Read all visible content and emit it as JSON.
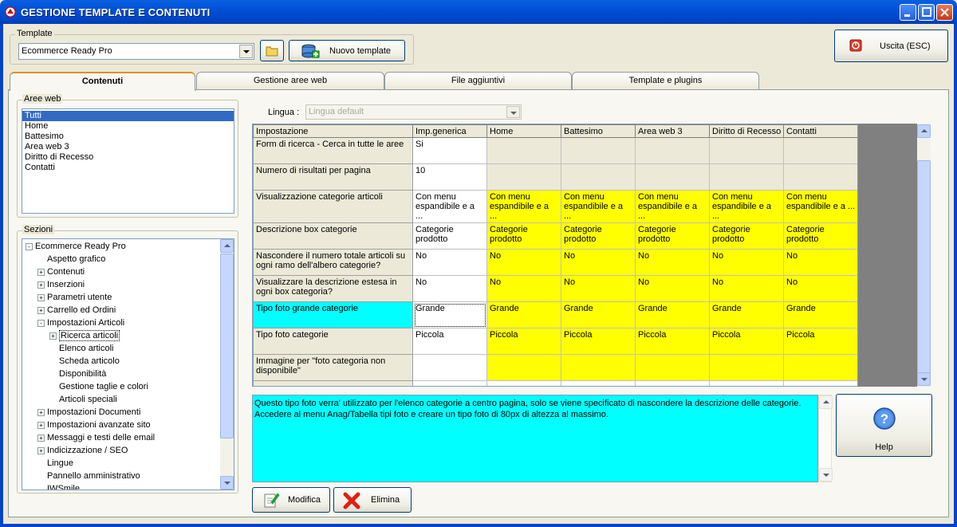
{
  "window": {
    "title": "GESTIONE TEMPLATE E CONTENUTI"
  },
  "template_group": {
    "legend": "Template",
    "selected": "Ecommerce Ready Pro",
    "new_template_label": "Nuovo template"
  },
  "exit_label": "Uscita (ESC)",
  "tabs": [
    "Contenuti",
    "Gestione aree web",
    "File aggiuntivi",
    "Template e plugins"
  ],
  "aree_web": {
    "legend": "Aree web",
    "items": [
      "Tutti",
      "Home",
      "Battesimo",
      "Area web 3",
      "Diritto di Recesso",
      "Contatti"
    ]
  },
  "sezioni": {
    "legend": "Sezioni",
    "nodes": [
      {
        "label": "Ecommerce Ready Pro",
        "level": 0,
        "pm": "-"
      },
      {
        "label": "Aspetto grafico",
        "level": 1,
        "pm": ""
      },
      {
        "label": "Contenuti",
        "level": 1,
        "pm": "+"
      },
      {
        "label": "Inserzioni",
        "level": 1,
        "pm": "+"
      },
      {
        "label": "Parametri utente",
        "level": 1,
        "pm": "+"
      },
      {
        "label": "Carrello ed Ordini",
        "level": 1,
        "pm": "+"
      },
      {
        "label": "Impostazioni Articoli",
        "level": 1,
        "pm": "-"
      },
      {
        "label": "Ricerca articoli",
        "level": 2,
        "pm": "+"
      },
      {
        "label": "Elenco articoli",
        "level": 2,
        "pm": ""
      },
      {
        "label": "Scheda articolo",
        "level": 2,
        "pm": ""
      },
      {
        "label": "Disponibilità",
        "level": 2,
        "pm": ""
      },
      {
        "label": "Gestione taglie e colori",
        "level": 2,
        "pm": ""
      },
      {
        "label": "Articoli speciali",
        "level": 2,
        "pm": ""
      },
      {
        "label": "Impostazioni Documenti",
        "level": 1,
        "pm": "+"
      },
      {
        "label": "Impostazioni avanzate sito",
        "level": 1,
        "pm": "+"
      },
      {
        "label": "Messaggi e testi delle email",
        "level": 1,
        "pm": "+"
      },
      {
        "label": "Indicizzazione / SEO",
        "level": 1,
        "pm": "+"
      },
      {
        "label": "Lingue",
        "level": 1,
        "pm": ""
      },
      {
        "label": "Pannello amministrativo",
        "level": 1,
        "pm": ""
      },
      {
        "label": "IWSmile",
        "level": 1,
        "pm": ""
      }
    ]
  },
  "lingua": {
    "label": "Lingua :",
    "value": "Lingua default"
  },
  "grid": {
    "columns": [
      "Impostazione",
      "Imp.generica",
      "Home",
      "Battesimo",
      "Area web 3",
      "Diritto di Recesso",
      "Contatti"
    ],
    "rows": [
      {
        "name": "Form di ricerca - Cerca in tutte le aree",
        "generic": "Si",
        "areas": [
          "",
          "",
          "",
          "",
          ""
        ],
        "style": "empty"
      },
      {
        "name": "Numero di risultati per pagina",
        "generic": "10",
        "areas": [
          "",
          "",
          "",
          "",
          ""
        ],
        "style": "empty"
      },
      {
        "name": "Visualizzazione categorie articoli",
        "generic": "Con menu espandibile e a ...",
        "areas": [
          "Con menu espandibile e a ...",
          "Con menu espandibile e a ...",
          "Con menu espandibile e a ...",
          "Con menu espandibile e a ...",
          "Con menu espandibile e a ..."
        ],
        "style": "yellow"
      },
      {
        "name": "Descrizione box categorie",
        "generic": "Categorie prodotto",
        "areas": [
          "Categorie prodotto",
          "Categorie prodotto",
          "Categorie prodotto",
          "Categorie prodotto",
          "Categorie prodotto"
        ],
        "style": "yellow"
      },
      {
        "name": "Nascondere il numero totale articoli su ogni ramo dell'albero categorie?",
        "generic": "No",
        "areas": [
          "No",
          "No",
          "No",
          "No",
          "No"
        ],
        "style": "yellow"
      },
      {
        "name": "Visualizzare la descrizione estesa in ogni box categoria?",
        "generic": "No",
        "areas": [
          "No",
          "No",
          "No",
          "No",
          "No"
        ],
        "style": "yellow"
      },
      {
        "name": "Tipo foto grande categorie",
        "generic": "Grande",
        "areas": [
          "Grande",
          "Grande",
          "Grande",
          "Grande",
          "Grande"
        ],
        "style": "yellow",
        "selected": true
      },
      {
        "name": "Tipo foto categorie",
        "generic": "Piccola",
        "areas": [
          "Piccola",
          "Piccola",
          "Piccola",
          "Piccola",
          "Piccola"
        ],
        "style": "yellow"
      },
      {
        "name": "Immagine per \"foto categoria non disponibile\"",
        "generic": "",
        "areas": [
          "",
          "",
          "",
          "",
          ""
        ],
        "style": "yellow"
      }
    ]
  },
  "description": "Questo tipo foto verra' utilizzato per l'elenco categorie a centro pagina, solo se viene specificato di nascondere la descrizione delle categorie. Accedere al menu Anag/Tabella tipi foto e creare un tipo foto di 80px di altezza al massimo.",
  "help_label": "Help",
  "modifica_label": "Modifica",
  "elimina_label": "Elimina",
  "colors": {
    "titlebar": "#0050d8",
    "selection": "#316ac5",
    "area_value": "#ffff00",
    "selected_row": "#00ffff"
  }
}
